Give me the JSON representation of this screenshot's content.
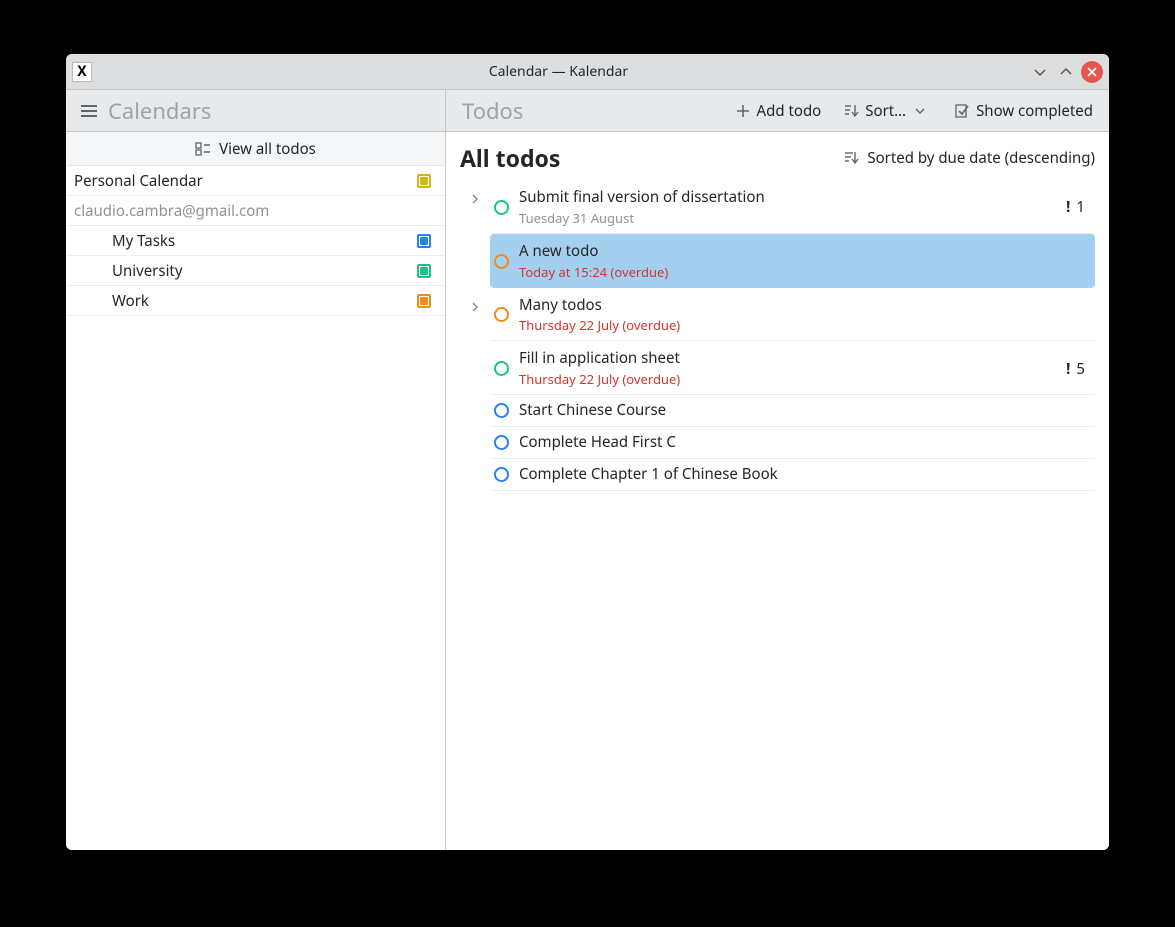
{
  "window_title": "Calendar — Kalendar",
  "sidebar_header": "Calendars",
  "main_header_title": "Todos",
  "toolbar": {
    "add_todo": "Add todo",
    "sort": "Sort…",
    "show_completed": "Show completed",
    "view_all": "View all todos"
  },
  "main": {
    "heading": "All todos",
    "sorted_by": "Sorted by due date (descending)"
  },
  "calendars": {
    "top": {
      "name": "Personal Calendar",
      "color": "#d2b617"
    },
    "account": "claudio.cambra@gmail.com",
    "subs": [
      {
        "name": "My Tasks",
        "color": "#2980f3"
      },
      {
        "name": "University",
        "color": "#17c487"
      },
      {
        "name": "Work",
        "color": "#f08c1e"
      }
    ]
  },
  "todos": [
    {
      "title": "Submit final version of dissertation",
      "sub": "Tuesday 31 August",
      "overdue": false,
      "color": "#17c487",
      "expandable": true,
      "selected": false,
      "priority": "1"
    },
    {
      "title": "A new todo",
      "sub": "Today at 15:24 (overdue)",
      "overdue": true,
      "color": "#f08c1e",
      "expandable": false,
      "selected": true
    },
    {
      "title": "Many todos",
      "sub": "Thursday 22 July (overdue)",
      "overdue": true,
      "color": "#f08c1e",
      "expandable": true,
      "selected": false
    },
    {
      "title": "Fill in application sheet",
      "sub": "Thursday 22 July (overdue)",
      "overdue": true,
      "color": "#17c487",
      "expandable": false,
      "selected": false,
      "priority": "5"
    },
    {
      "title": "Start Chinese Course",
      "color": "#2980f3",
      "expandable": false,
      "selected": false
    },
    {
      "title": "Complete Head First C",
      "color": "#2980f3",
      "expandable": false,
      "selected": false
    },
    {
      "title": "Complete Chapter 1 of Chinese Book",
      "color": "#2980f3",
      "expandable": false,
      "selected": false
    }
  ]
}
